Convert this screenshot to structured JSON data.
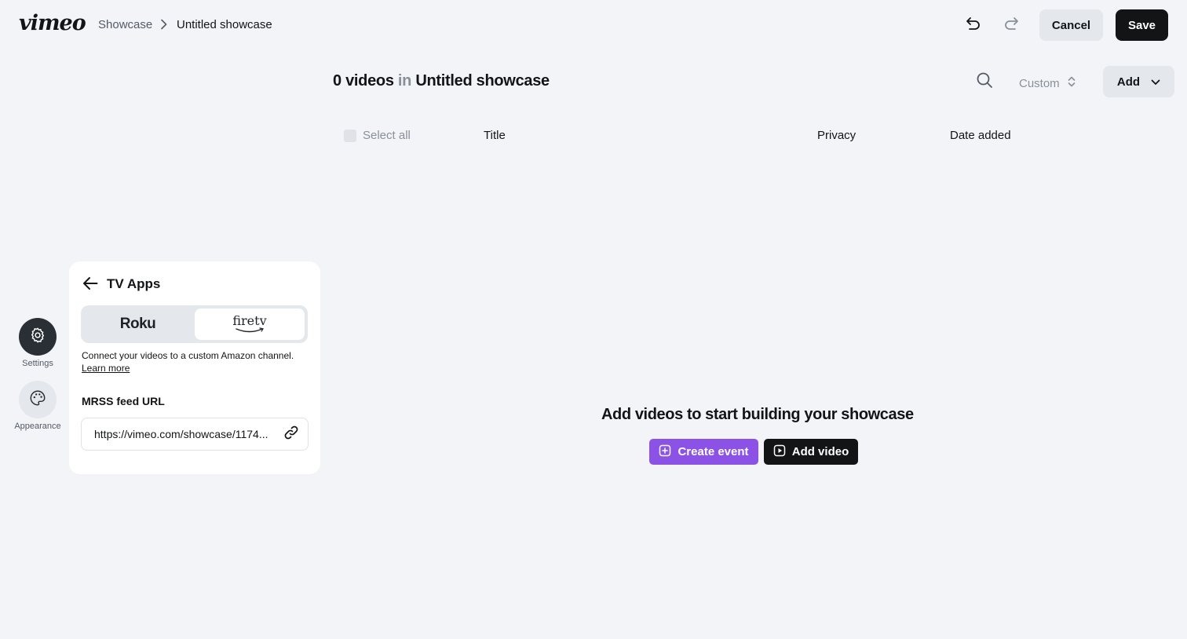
{
  "header": {
    "logo": "vimeo",
    "breadcrumb": {
      "parent": "Showcase",
      "current": "Untitled showcase"
    },
    "cancel_label": "Cancel",
    "save_label": "Save"
  },
  "content": {
    "count_label": "0 videos",
    "in_label": "in",
    "showcase_name": "Untitled showcase",
    "sort_label": "Custom",
    "add_label": "Add"
  },
  "table": {
    "select_all": "Select all",
    "columns": [
      "Title",
      "Privacy",
      "Date added"
    ]
  },
  "empty_state": {
    "message": "Add videos to start building your showcase",
    "create_event": "Create event",
    "add_video": "Add video"
  },
  "rail": {
    "items": [
      {
        "label": "Settings",
        "icon": "gear-icon"
      },
      {
        "label": "Appearance",
        "icon": "palette-icon"
      }
    ]
  },
  "panel": {
    "title": "TV Apps",
    "tabs": {
      "roku": "Roku",
      "firetv": "firetv"
    },
    "description": "Connect your videos to a custom Amazon channel.",
    "learn_more": "Learn more",
    "mrss_label": "MRSS feed URL",
    "mrss_url": "https://vimeo.com/showcase/1174..."
  },
  "colors": {
    "background": "#f2f4f7",
    "primary_dark": "#121416",
    "accent_purple": "#8c52e6",
    "button_gray": "#e4e7eb"
  }
}
